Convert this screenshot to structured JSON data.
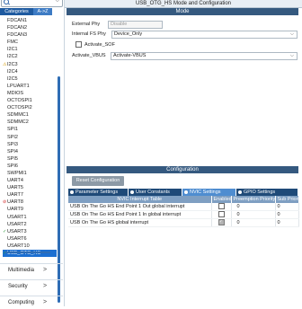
{
  "sidebar": {
    "search": {
      "value": "",
      "placeholder": ""
    },
    "tabs": {
      "categories": "Categories",
      "az": "A->Z"
    },
    "items": [
      {
        "label": "FDCAN1",
        "marker": ""
      },
      {
        "label": "FDCAN2",
        "marker": ""
      },
      {
        "label": "FDCAN3",
        "marker": ""
      },
      {
        "label": "FMC",
        "marker": ""
      },
      {
        "label": "I2C1",
        "marker": ""
      },
      {
        "label": "I2C2",
        "marker": ""
      },
      {
        "label": "I2C3",
        "marker": "warn"
      },
      {
        "label": "I2C4",
        "marker": ""
      },
      {
        "label": "I2C5",
        "marker": ""
      },
      {
        "label": "LPUART1",
        "marker": ""
      },
      {
        "label": "MDIOS",
        "marker": ""
      },
      {
        "label": "OCTOSPI1",
        "marker": ""
      },
      {
        "label": "OCTOSPI2",
        "marker": ""
      },
      {
        "label": "SDMMC1",
        "marker": ""
      },
      {
        "label": "SDMMC2",
        "marker": ""
      },
      {
        "label": "SPI1",
        "marker": ""
      },
      {
        "label": "SPI2",
        "marker": ""
      },
      {
        "label": "SPI3",
        "marker": ""
      },
      {
        "label": "SPI4",
        "marker": ""
      },
      {
        "label": "SPI5",
        "marker": ""
      },
      {
        "label": "SPI6",
        "marker": ""
      },
      {
        "label": "SWPMI1",
        "marker": ""
      },
      {
        "label": "UART4",
        "marker": ""
      },
      {
        "label": "UART5",
        "marker": ""
      },
      {
        "label": "UART7",
        "marker": ""
      },
      {
        "label": "UART8",
        "marker": "err"
      },
      {
        "label": "UART9",
        "marker": ""
      },
      {
        "label": "USART1",
        "marker": ""
      },
      {
        "label": "USART2",
        "marker": ""
      },
      {
        "label": "USART3",
        "marker": "ok"
      },
      {
        "label": "USART6",
        "marker": ""
      },
      {
        "label": "USART10",
        "marker": ""
      },
      {
        "label": "USB_OTG_HS",
        "marker": "ok",
        "selected": true
      }
    ],
    "sections": [
      {
        "label": "Multimedia"
      },
      {
        "label": "Security"
      },
      {
        "label": "Computing"
      }
    ]
  },
  "main": {
    "title": "USB_OTG_HS Mode and Configuration",
    "mode_header": "Mode",
    "external_phy": {
      "label": "External Phy",
      "value": "Disable"
    },
    "internal_phy": {
      "label": "Internal FS Phy",
      "value": "Device_Only"
    },
    "activate_sof": {
      "label": "Activate_SOF",
      "checked": false
    },
    "activate_vbus": {
      "label": "Activate_VBUS",
      "value": "Activate-VBUS"
    },
    "config_header": "Configuration",
    "reset_button": "Reset Configuration",
    "config_tabs": [
      {
        "label": "Parameter Settings",
        "active": false
      },
      {
        "label": "User Constants",
        "active": false
      },
      {
        "label": "NVIC Settings",
        "active": true
      },
      {
        "label": "GPIO Settings",
        "active": false
      }
    ],
    "nvic_table": {
      "headers": [
        "NVIC Interrupt Table",
        "Enabled",
        "Preemption Priority",
        "Sub Priority"
      ],
      "rows": [
        {
          "name": "USB On The Go HS End Point 1 Out global interrupt",
          "enabled": false,
          "preemption": "0",
          "sub": "0"
        },
        {
          "name": "USB On The Go HS End Point 1 In global interrupt",
          "enabled": false,
          "preemption": "0",
          "sub": "0"
        },
        {
          "name": "USB On The Go HS global interrupt",
          "enabled": true,
          "preemption": "0",
          "sub": "0"
        }
      ]
    }
  }
}
